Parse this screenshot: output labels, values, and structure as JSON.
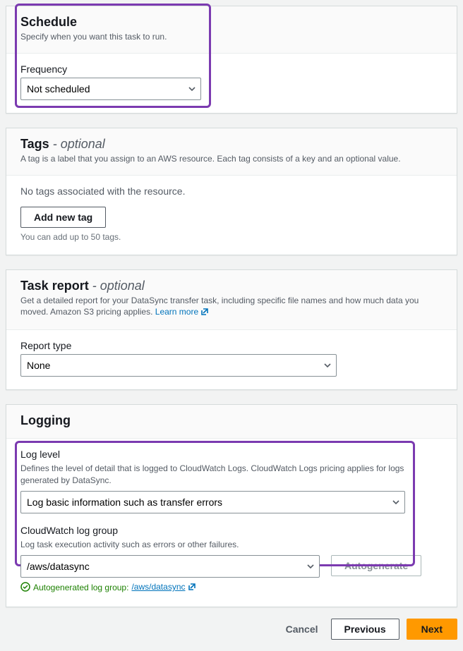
{
  "schedule": {
    "title": "Schedule",
    "desc": "Specify when you want this task to run.",
    "frequency_label": "Frequency",
    "frequency_value": "Not scheduled"
  },
  "tags": {
    "title": "Tags",
    "optional": "- optional",
    "desc": "A tag is a label that you assign to an AWS resource. Each tag consists of a key and an optional value.",
    "no_tags": "No tags associated with the resource.",
    "add_button": "Add new tag",
    "hint": "You can add up to 50 tags."
  },
  "task_report": {
    "title": "Task report",
    "optional": "- optional",
    "desc": "Get a detailed report for your DataSync transfer task, including specific file names and how much data you moved. Amazon S3 pricing applies. ",
    "learn_more": "Learn more",
    "report_type_label": "Report type",
    "report_type_value": "None"
  },
  "logging": {
    "title": "Logging",
    "log_level_label": "Log level",
    "log_level_desc": "Defines the level of detail that is logged to CloudWatch Logs. CloudWatch Logs pricing applies for logs generated by DataSync.",
    "log_level_value": "Log basic information such as transfer errors",
    "log_group_label": "CloudWatch log group",
    "log_group_desc": "Log task execution activity such as errors or other failures.",
    "log_group_value": "/aws/datasync",
    "autogenerate": "Autogenerate",
    "status_text": "Autogenerated log group: ",
    "status_link": "/aws/datasync"
  },
  "footer": {
    "cancel": "Cancel",
    "previous": "Previous",
    "next": "Next"
  }
}
